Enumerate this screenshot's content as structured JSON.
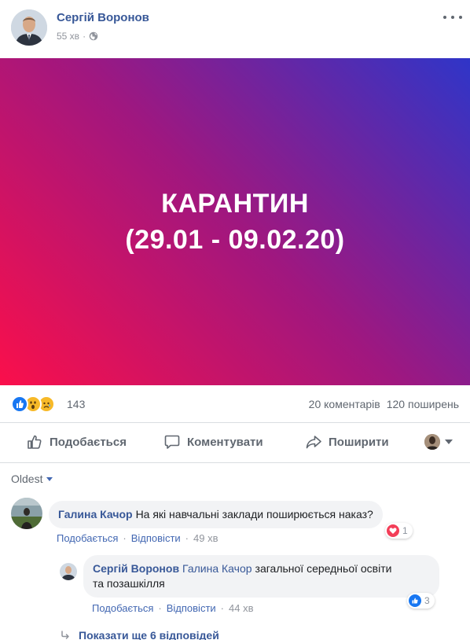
{
  "post": {
    "author": "Сергій Воронов",
    "time": "55 хв",
    "separator": "·",
    "privacy_icon": "globe-icon"
  },
  "banner": {
    "line1": "КАРАНТИН",
    "line2": "(29.01 - 09.02.20)",
    "gradient_start": "#fa0f4b",
    "gradient_end": "#2f35c8"
  },
  "stats": {
    "reaction_icons": [
      "like-icon",
      "wow-icon",
      "sad-icon"
    ],
    "reaction_count": "143",
    "comments": "20 коментарів",
    "shares": "120 поширень"
  },
  "actions": {
    "like": "Подобається",
    "comment": "Коментувати",
    "share": "Поширити"
  },
  "comment_order": "Oldest",
  "comments": [
    {
      "author": "Галина Качор",
      "text": "На які навчальні заклади поширюється наказ?",
      "like_label": "Подобається",
      "reply_label": "Відповісти",
      "time": "49 хв",
      "reaction_icon": "heart-icon",
      "reaction_count": "1"
    }
  ],
  "reply": {
    "author": "Сергій Воронов",
    "mention": "Галина Качор",
    "text_line1": "загальної середньої освіти",
    "text_line2": "та позашкілля",
    "like_label": "Подобається",
    "reply_label": "Відповісти",
    "time": "44 хв",
    "reaction_icon": "like-icon",
    "reaction_count": "3"
  },
  "more_replies": "Показати ще 6 відповідей",
  "colors": {
    "link": "#385898",
    "muted": "#90949c",
    "bubble": "#f2f3f5"
  }
}
